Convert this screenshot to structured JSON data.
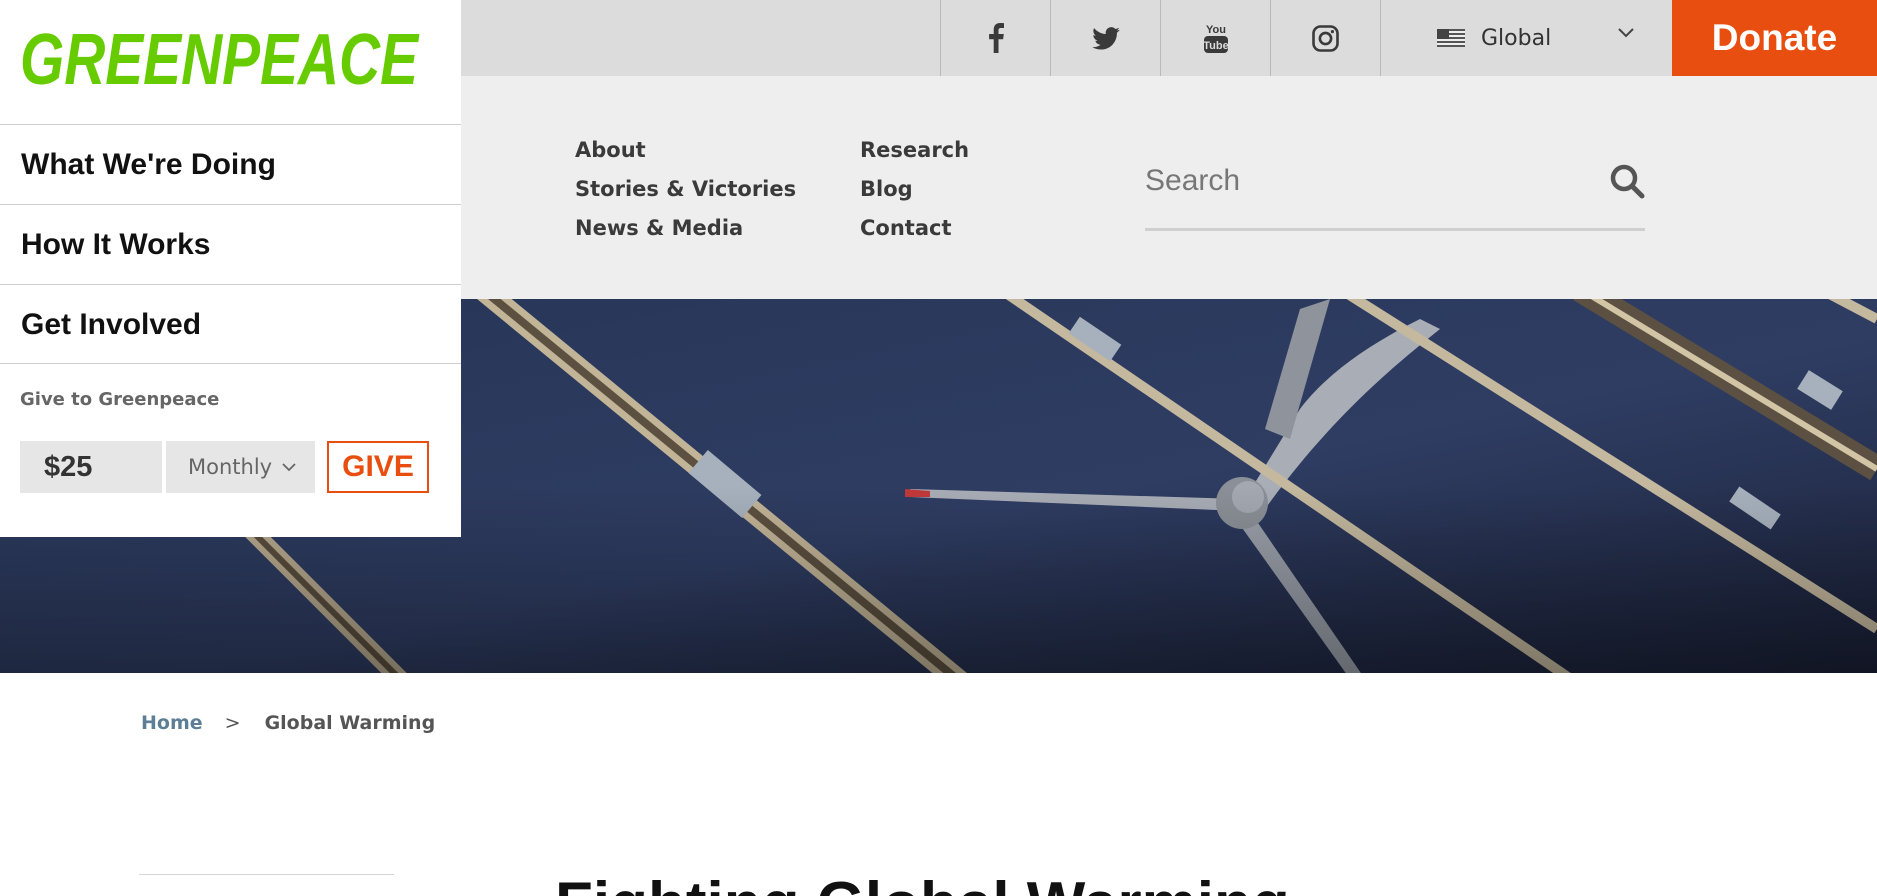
{
  "header": {
    "logo_text": "GREENPEACE",
    "brand_color": "#66cc00",
    "accent_color": "#e84e0f",
    "social": [
      {
        "name": "facebook",
        "icon": "facebook-icon"
      },
      {
        "name": "twitter",
        "icon": "twitter-icon"
      },
      {
        "name": "youtube",
        "icon": "youtube-icon"
      },
      {
        "name": "instagram",
        "icon": "instagram-icon"
      }
    ],
    "region_label": "Global",
    "region_flag": "us-flag-icon",
    "donate_label": "Donate"
  },
  "sidebar": {
    "menu": [
      {
        "label": "What We're Doing"
      },
      {
        "label": "How It Works"
      },
      {
        "label": "Get Involved"
      }
    ],
    "give": {
      "title": "Give to Greenpeace",
      "amount": "$25",
      "frequency": "Monthly",
      "button": "GIVE"
    }
  },
  "nav": {
    "col1": [
      {
        "label": "About"
      },
      {
        "label": "Stories & Victories"
      },
      {
        "label": "News & Media"
      }
    ],
    "col2": [
      {
        "label": "Research"
      },
      {
        "label": "Blog"
      },
      {
        "label": "Contact"
      }
    ]
  },
  "search": {
    "placeholder": "Search",
    "value": ""
  },
  "breadcrumb": {
    "home": "Home",
    "separator": ">",
    "current": "Global Warming"
  },
  "page": {
    "title": "Fighting Global Warming"
  }
}
